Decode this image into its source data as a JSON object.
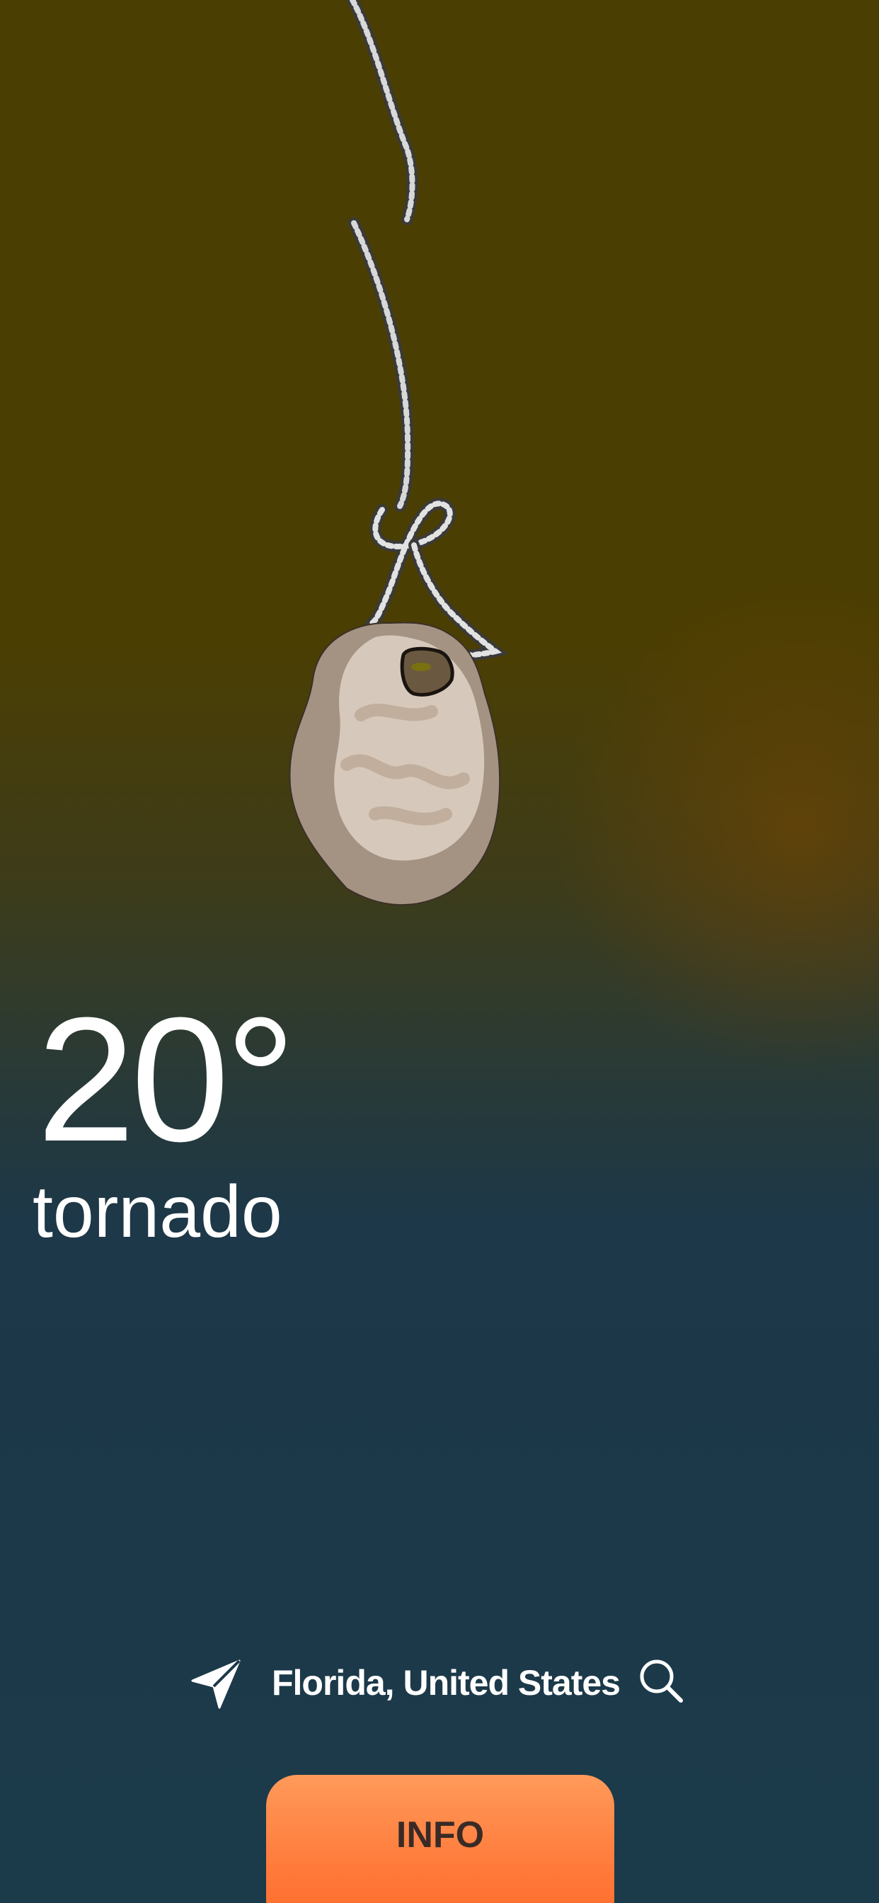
{
  "weather": {
    "temperature": "20°",
    "condition": "tornado"
  },
  "location": {
    "name": "Florida, United States",
    "locate_icon": "location-arrow-icon",
    "search_icon": "search-icon"
  },
  "info_button": {
    "label": "INFO"
  },
  "illustration": {
    "name": "weather-stone"
  },
  "colors": {
    "background_top": "#4b3e02",
    "background_bottom": "#1b3a4a",
    "button_orange": "#ff7a3a",
    "text_white": "#ffffff"
  }
}
